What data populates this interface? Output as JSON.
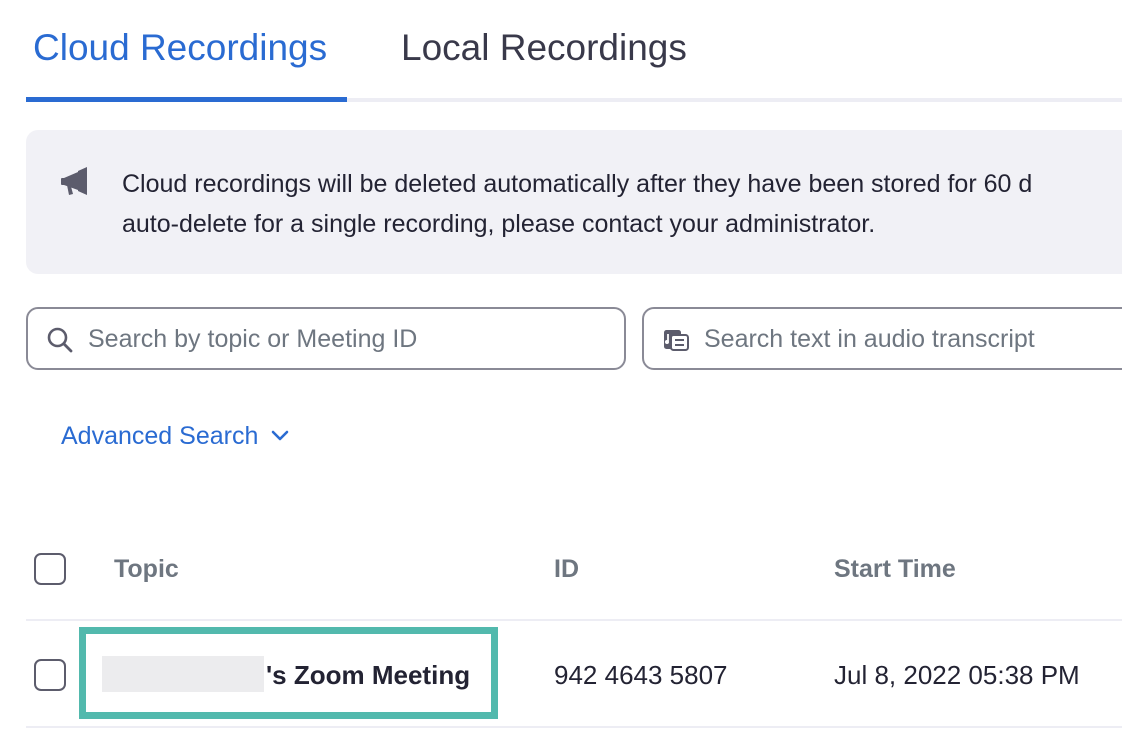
{
  "tabs": [
    {
      "label": "Cloud Recordings",
      "active": true
    },
    {
      "label": "Local Recordings",
      "active": false
    }
  ],
  "notice": {
    "icon": "megaphone-icon",
    "line1": "Cloud recordings will be deleted automatically after they have been stored for 60 d",
    "line2": "auto-delete for a single recording, please contact your administrator."
  },
  "search": {
    "topic_placeholder": "Search by topic or Meeting ID",
    "topic_value": "",
    "transcript_placeholder": "Search text in audio transcript",
    "transcript_value": ""
  },
  "advanced_search": {
    "label": "Advanced Search"
  },
  "table": {
    "headers": [
      "Topic",
      "ID",
      "Start Time"
    ],
    "rows": [
      {
        "topic": "'s Zoom Meeting",
        "id": "942 4643 5807",
        "start_time": "Jul 8, 2022 05:38 PM"
      }
    ]
  },
  "colors": {
    "accent": "#2a6bd2",
    "highlight": "#52b9ad",
    "notice_bg": "#f1f1f6",
    "muted_text": "#6e7680"
  }
}
